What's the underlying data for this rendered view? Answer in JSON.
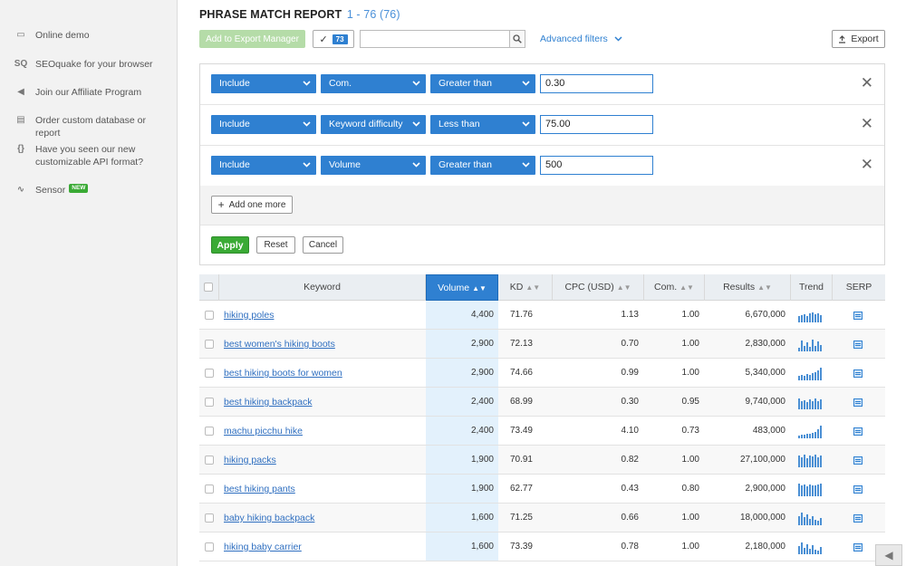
{
  "sidebar": {
    "items": [
      {
        "icon": "monitor-icon",
        "glyph": "▭",
        "label": "Online demo"
      },
      {
        "icon": "seoquake-icon",
        "glyph": "SQ",
        "label": "SEOquake for your browser"
      },
      {
        "icon": "megaphone-icon",
        "glyph": "◀",
        "label": "Join our Affiliate Program"
      },
      {
        "icon": "clipboard-icon",
        "glyph": "▤",
        "label": "Order custom database or report"
      },
      {
        "icon": "braces-icon",
        "glyph": "{}",
        "label": "Have you seen our new customizable API format?"
      },
      {
        "icon": "pulse-icon",
        "glyph": "∿",
        "label": "Sensor",
        "badge": "NEW"
      }
    ]
  },
  "header": {
    "title": "PHRASE MATCH REPORT",
    "range": "1 - 76 (76)"
  },
  "toolbar": {
    "export_manager_label": "Add to Export Manager",
    "selected_count": "73",
    "search_value": "",
    "advanced_filters_label": "Advanced filters",
    "export_label": "Export"
  },
  "filters": {
    "rows": [
      {
        "mode": "Include",
        "field": "Com.",
        "operator": "Greater than",
        "value": "0.30"
      },
      {
        "mode": "Include",
        "field": "Keyword difficulty",
        "operator": "Less than",
        "value": "75.00"
      },
      {
        "mode": "Include",
        "field": "Volume",
        "operator": "Greater than",
        "value": "500"
      }
    ],
    "add_label": "Add one more",
    "apply_label": "Apply",
    "reset_label": "Reset",
    "cancel_label": "Cancel"
  },
  "table": {
    "columns": {
      "keyword": "Keyword",
      "volume": "Volume",
      "kd": "KD",
      "cpc": "CPC (USD)",
      "com": "Com.",
      "results": "Results",
      "trend": "Trend",
      "serp": "SERP"
    },
    "rows": [
      {
        "keyword": "hiking poles",
        "volume": "4,400",
        "kd": "71.76",
        "cpc": "1.13",
        "com": "1.00",
        "results": "6,670,000",
        "trend": [
          7,
          8,
          9,
          7,
          10,
          11,
          9,
          10,
          8
        ]
      },
      {
        "keyword": "best women's hiking boots",
        "volume": "2,900",
        "kd": "72.13",
        "cpc": "0.70",
        "com": "1.00",
        "results": "2,830,000",
        "trend": [
          4,
          12,
          6,
          10,
          5,
          13,
          6,
          11,
          7
        ]
      },
      {
        "keyword": "best hiking boots for women",
        "volume": "2,900",
        "kd": "74.66",
        "cpc": "0.99",
        "com": "1.00",
        "results": "5,340,000",
        "trend": [
          5,
          6,
          5,
          7,
          6,
          8,
          9,
          11,
          14
        ]
      },
      {
        "keyword": "best hiking backpack",
        "volume": "2,400",
        "kd": "68.99",
        "cpc": "0.30",
        "com": "0.95",
        "results": "9,740,000",
        "trend": [
          12,
          9,
          10,
          8,
          11,
          9,
          12,
          9,
          11
        ]
      },
      {
        "keyword": "machu picchu hike",
        "volume": "2,400",
        "kd": "73.49",
        "cpc": "4.10",
        "com": "0.73",
        "results": "483,000",
        "trend": [
          3,
          4,
          4,
          5,
          5,
          6,
          7,
          10,
          14
        ]
      },
      {
        "keyword": "hiking packs",
        "volume": "1,900",
        "kd": "70.91",
        "cpc": "0.82",
        "com": "1.00",
        "results": "27,100,000",
        "trend": [
          13,
          11,
          14,
          10,
          13,
          12,
          14,
          11,
          13
        ]
      },
      {
        "keyword": "best hiking pants",
        "volume": "1,900",
        "kd": "62.77",
        "cpc": "0.43",
        "com": "0.80",
        "results": "2,900,000",
        "trend": [
          14,
          12,
          13,
          11,
          13,
          12,
          12,
          13,
          14
        ]
      },
      {
        "keyword": "baby hiking backpack",
        "volume": "1,600",
        "kd": "71.25",
        "cpc": "0.66",
        "com": "1.00",
        "results": "18,000,000",
        "trend": [
          10,
          14,
          9,
          12,
          7,
          10,
          6,
          5,
          8
        ]
      },
      {
        "keyword": "hiking baby carrier",
        "volume": "1,600",
        "kd": "73.39",
        "cpc": "0.78",
        "com": "1.00",
        "results": "2,180,000",
        "trend": [
          9,
          13,
          7,
          11,
          6,
          10,
          5,
          4,
          8
        ]
      }
    ]
  },
  "colors": {
    "accent": "#2f80d1",
    "apply": "#3aaa35",
    "volume_highlight": "#e3f1fc"
  }
}
